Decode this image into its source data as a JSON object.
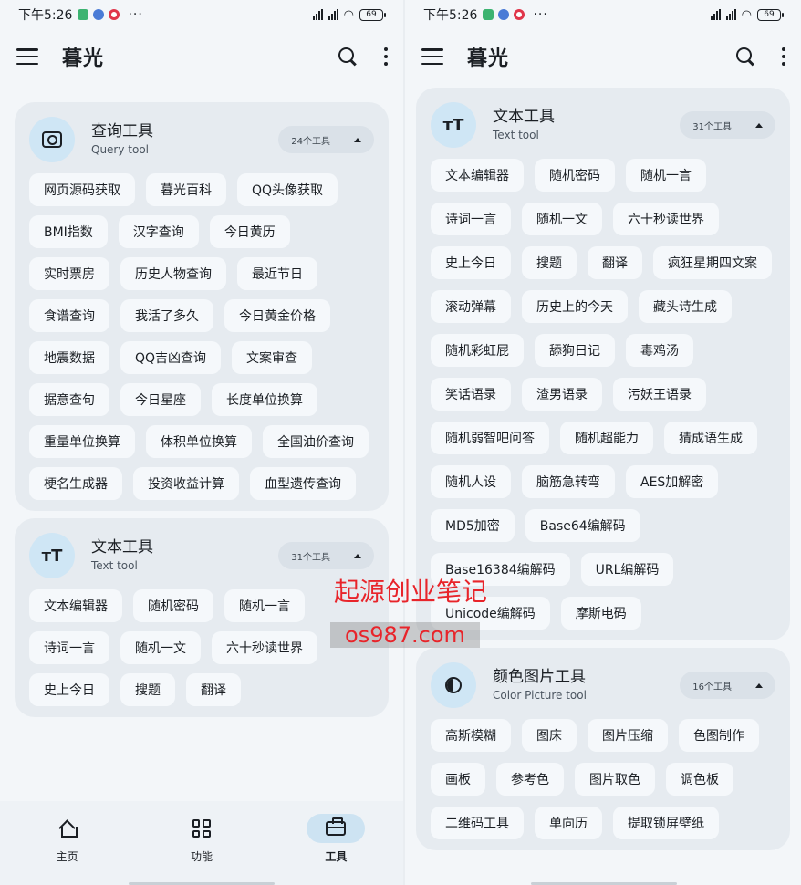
{
  "status_bar": {
    "time": "下午5:26",
    "dots": "···",
    "battery": "69"
  },
  "app_bar": {
    "title": "暮光"
  },
  "watermark": {
    "text": "起源创业笔记",
    "url": "os987.com"
  },
  "left_screen": {
    "cards": [
      {
        "title": "查询工具",
        "subtitle": "Query tool",
        "count": "24个工具",
        "icon": "query-icon",
        "tools": [
          "网页源码获取",
          "暮光百科",
          "QQ头像获取",
          "BMI指数",
          "汉字查询",
          "今日黄历",
          "实时票房",
          "历史人物查询",
          "最近节日",
          "食谱查询",
          "我活了多久",
          "今日黄金价格",
          "地震数据",
          "QQ吉凶查询",
          "文案审查",
          "据意查句",
          "今日星座",
          "长度单位换算",
          "重量单位换算",
          "体积单位换算",
          "全国油价查询",
          "梗名生成器",
          "投资收益计算",
          "血型遗传查询"
        ]
      },
      {
        "title": "文本工具",
        "subtitle": "Text tool",
        "count": "31个工具",
        "icon": "text-icon",
        "avatar_text": "тT",
        "tools": [
          "文本编辑器",
          "随机密码",
          "随机一言",
          "诗词一言",
          "随机一文",
          "六十秒读世界",
          "史上今日",
          "搜题",
          "翻译"
        ]
      }
    ]
  },
  "right_screen": {
    "cards": [
      {
        "title": "文本工具",
        "subtitle": "Text tool",
        "count": "31个工具",
        "icon": "text-icon",
        "avatar_text": "тT",
        "tools": [
          "文本编辑器",
          "随机密码",
          "随机一言",
          "诗词一言",
          "随机一文",
          "六十秒读世界",
          "史上今日",
          "搜题",
          "翻译",
          "疯狂星期四文案",
          "滚动弹幕",
          "历史上的今天",
          "藏头诗生成",
          "随机彩虹屁",
          "舔狗日记",
          "毒鸡汤",
          "笑话语录",
          "渣男语录",
          "污妖王语录",
          "随机弱智吧问答",
          "随机超能力",
          "猜成语生成",
          "随机人设",
          "脑筋急转弯",
          "AES加解密",
          "MD5加密",
          "Base64编解码",
          "Base16384编解码",
          "URL编解码",
          "Unicode编解码",
          "摩斯电码"
        ]
      },
      {
        "title": "颜色图片工具",
        "subtitle": "Color Picture tool",
        "count": "16个工具",
        "icon": "color-drop-icon",
        "tools": [
          "高斯模糊",
          "图床",
          "图片压缩",
          "色图制作",
          "画板",
          "参考色",
          "图片取色",
          "调色板",
          "二维码工具",
          "单向历",
          "提取锁屏壁纸"
        ]
      }
    ]
  },
  "bottom_nav": {
    "items": [
      {
        "label": "主页",
        "icon": "home-icon",
        "active": false
      },
      {
        "label": "功能",
        "icon": "grid-icon",
        "active": false
      },
      {
        "label": "工具",
        "icon": "toolbox-icon",
        "active": true
      }
    ]
  },
  "colors": {
    "background": "#f3f6f9",
    "card": "#e6ebf0",
    "chip": "#f5f8fb",
    "avatar": "#cfe6f5",
    "nav_active": "#cde3f2",
    "watermark": "#e8242a"
  }
}
